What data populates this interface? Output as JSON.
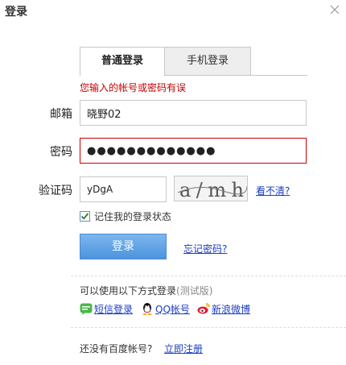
{
  "dialog": {
    "title": "登录",
    "close_icon": "close-icon"
  },
  "tabs": [
    {
      "label": "普通登录",
      "active": true
    },
    {
      "label": "手机登录",
      "active": false
    }
  ],
  "error": {
    "message": "您输入的帐号或密码有误"
  },
  "form": {
    "email_label": "邮箱",
    "email_value": "晓野02",
    "password_label": "密码",
    "password_value": "●●●●●●●●●●●●●",
    "captcha_label": "验证码",
    "captcha_value": "yDgA",
    "captcha_image_text": "a/mh",
    "refresh_link": "看不清?",
    "remember_label": "记住我的登录状态",
    "remember_checked": true,
    "login_button": "登录",
    "forgot_link": "忘记密码?"
  },
  "other_login": {
    "title": "可以使用以下方式登录",
    "beta": "(测试版)",
    "methods": [
      {
        "label": "短信登录",
        "icon": "sms-icon"
      },
      {
        "label": "QQ帐号",
        "icon": "qq-icon"
      },
      {
        "label": "新浪微博",
        "icon": "weibo-icon"
      }
    ]
  },
  "register": {
    "prompt": "还没有百度帐号?",
    "link": "立即注册"
  },
  "colors": {
    "error": "#c40000",
    "link": "#1a3dc1",
    "button": "#4d93dd"
  }
}
